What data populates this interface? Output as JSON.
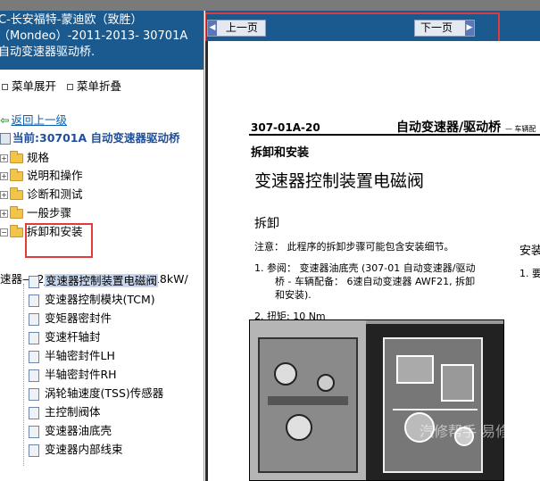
{
  "left": {
    "title_lines": [
      "C-长安福特-蒙迪欧（致胜）",
      "（Mondeo）-2011-2013- 30701A",
      "自动变速器驱动桥."
    ],
    "menu": {
      "expand": "菜单展开",
      "collapse": "菜单折叠"
    },
    "back_link": "返回上一级",
    "current": "当前:30701A 自动变速器驱动桥",
    "folders": [
      {
        "label": "规格"
      },
      {
        "label": "说明和操作"
      },
      {
        "label": "诊断和测试"
      },
      {
        "label": "一般步骤"
      },
      {
        "label": "拆卸和安装"
      }
    ],
    "engine": "速器— 2_3L Duratec—HE (118kW/",
    "items": [
      {
        "label": "变速器控制装置电磁阀"
      },
      {
        "label": "变速器控制模块(TCM)"
      },
      {
        "label": "变矩器密封件"
      },
      {
        "label": "变速杆轴封"
      },
      {
        "label": "半轴密封件LH"
      },
      {
        "label": "半轴密封件RH"
      },
      {
        "label": "涡轮轴速度(TSS)传感器"
      },
      {
        "label": "主控制阀体"
      },
      {
        "label": "变速器油底壳"
      },
      {
        "label": "变速器内部线束"
      }
    ]
  },
  "nav": {
    "prev": "上一页",
    "next": "下一页"
  },
  "doc": {
    "code": "307-01A-20",
    "header": "自动变速器/驱动桥",
    "header_small": "— 车辆配",
    "section": "拆卸和安装",
    "title": "变速器控制装置电磁阀",
    "sub": "拆卸",
    "note": "注意：   此程序的拆卸步骤可能包含安装细节。",
    "step1_a": "1.  参阅：  变速器油底壳 (307-01 自动变速器/驱动",
    "step1_b": "桥 - 车辆配备：  6速自动变速器 AWF21, 拆卸",
    "step1_c": "和安装).",
    "step2_prefix": "2.  扭矩:",
    "step2_value": "10 Nm",
    "right_col_title": "安装",
    "right_col_step": "1.  要"
  },
  "watermark": "汽修帮手 易修"
}
